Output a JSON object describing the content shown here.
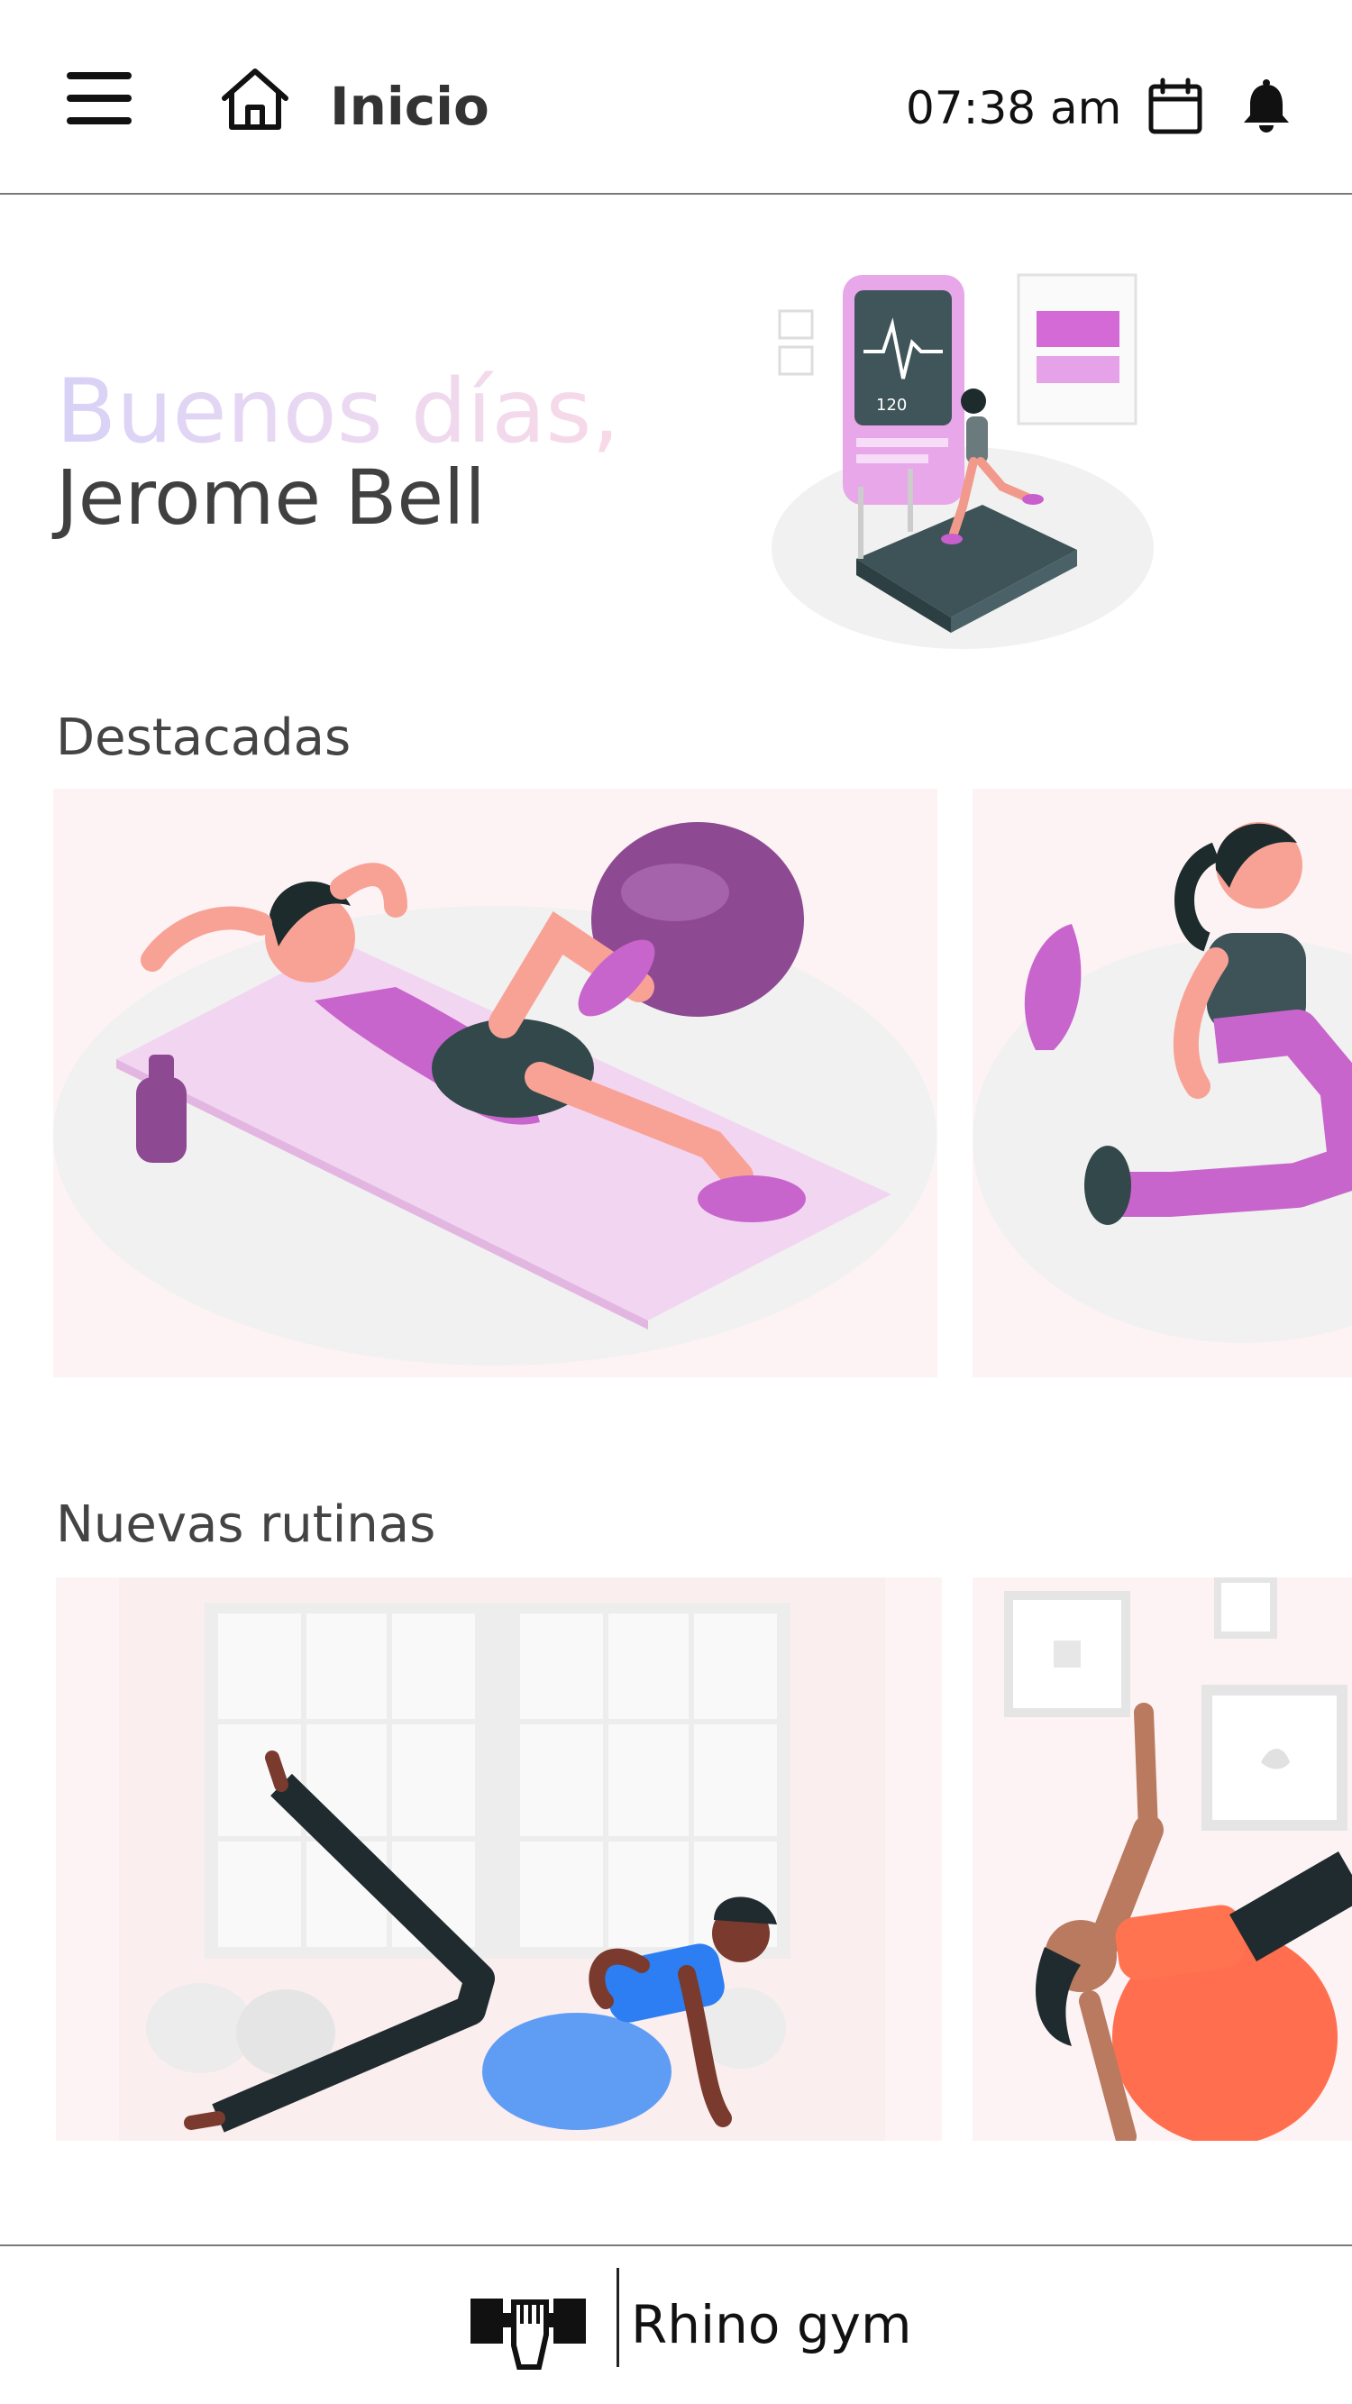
{
  "header": {
    "title": "Inicio",
    "time": "07:38 am",
    "icons": [
      "menu-icon",
      "home-icon",
      "calendar-icon",
      "bell-icon"
    ]
  },
  "greeting": {
    "line1": "Buenos días,",
    "line2": "Jerome Bell"
  },
  "sections": [
    {
      "title": "Destacadas"
    },
    {
      "title": "Nuevas rutinas"
    }
  ],
  "footer": {
    "brand": "Rhino gym",
    "logo": "gym-fist-logo-icon"
  },
  "colors": {
    "accent_purple": "#c65fcb",
    "card_bg": "#fdf3f4",
    "text_dark": "#3a3a3a"
  }
}
